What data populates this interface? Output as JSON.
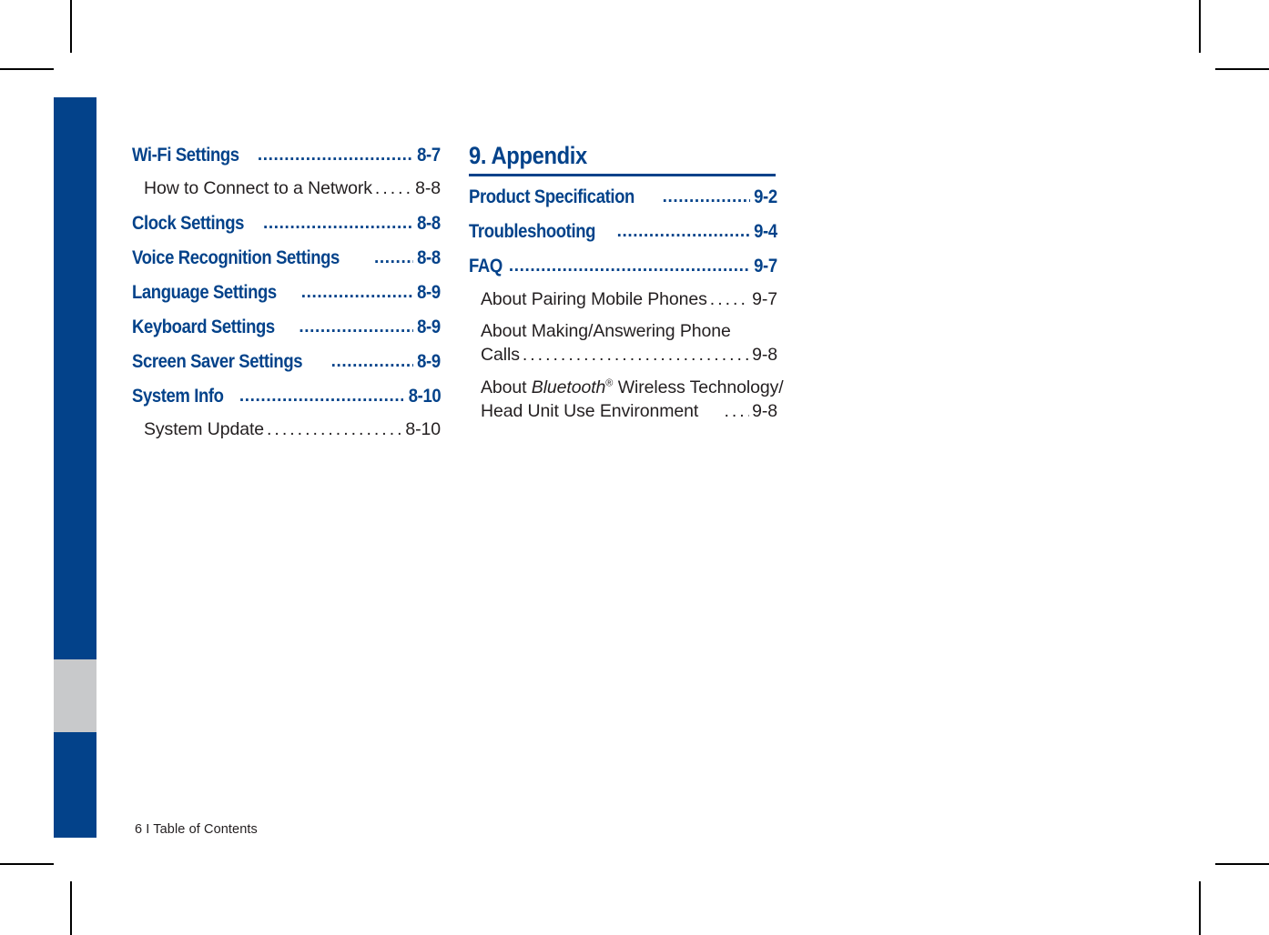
{
  "document": {
    "footer_text": "6 I Table of Contents",
    "brand_blue": "#03428a",
    "tab_gray": "#c8c9cb",
    "body_text_color": "#231f20"
  },
  "leader": {
    "main_dots": "................................................................................................................",
    "sub_dots": "......................................................................................"
  },
  "left_column": {
    "entries": [
      {
        "title": "Wi-Fi Settings",
        "page": "8-7"
      },
      {
        "title": "How to Connect to a Network",
        "page": "8-8"
      },
      {
        "title": "Clock Settings",
        "page": "8-8"
      },
      {
        "title": "Voice Recognition Settings",
        "page": "8-8"
      },
      {
        "title": "Language Settings",
        "page": "8-9"
      },
      {
        "title": "Keyboard Settings",
        "page": "8-9"
      },
      {
        "title": "Screen Saver Settings",
        "page": "8-9"
      },
      {
        "title": "System Info",
        "page": "8-10"
      },
      {
        "title": "System Update",
        "page": "8-10"
      }
    ]
  },
  "right_column": {
    "section_heading": "9. Appendix",
    "entries": [
      {
        "title": "Product Specification",
        "page": "9-2"
      },
      {
        "title": "Troubleshooting",
        "page": "9-4"
      },
      {
        "title": "FAQ",
        "page": "9-7"
      },
      {
        "title": "About Pairing Mobile Phones",
        "page": "9-7"
      },
      {
        "title_line1": "About Making/Answering Phone",
        "title_line2": "Calls",
        "page": "9-8"
      },
      {
        "title_line1_pre": "About ",
        "title_line1_italic": "Bluetooth",
        "title_line1_sup": "®",
        "title_line1_post": " Wireless Technology/",
        "title_line2": "Head Unit Use Environment",
        "page": "9-8"
      }
    ]
  }
}
